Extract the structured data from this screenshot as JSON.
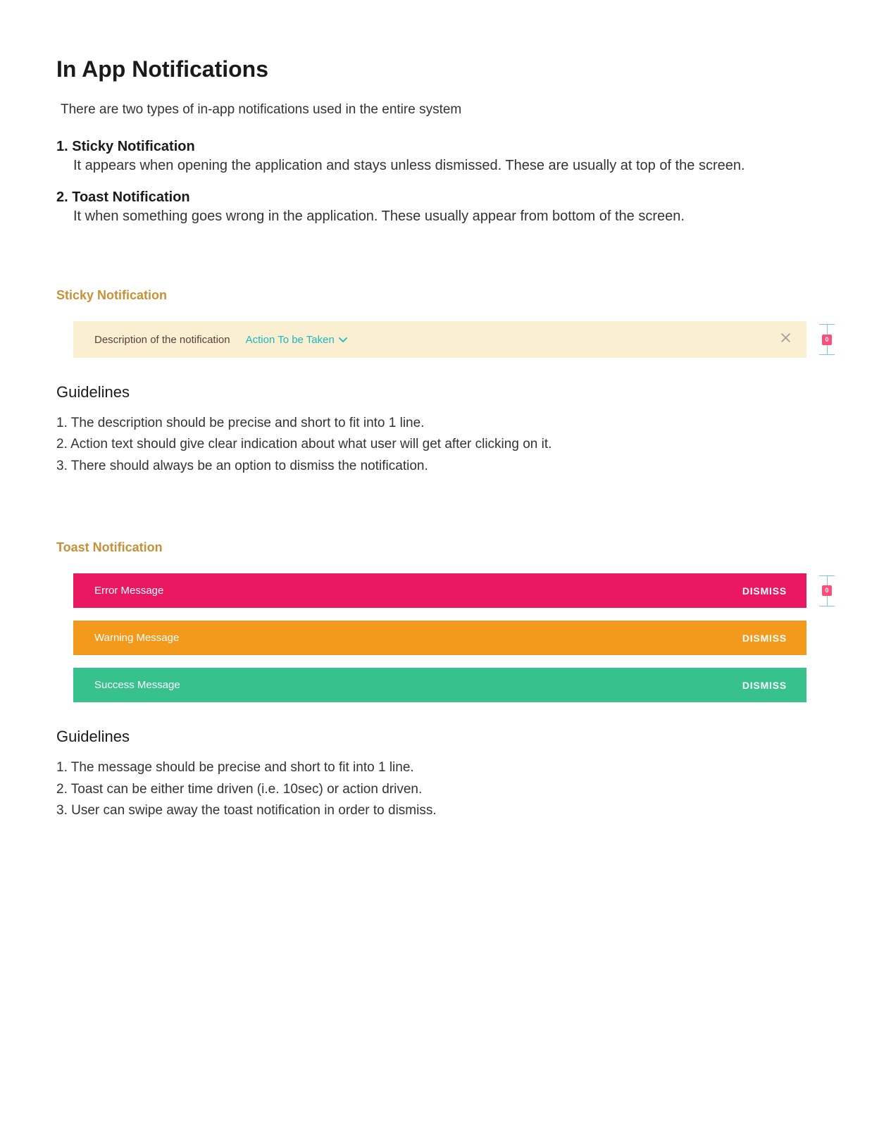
{
  "title": "In App Notifications",
  "intro": "There are two types of in-app notifications used in the entire system",
  "types": {
    "sticky": {
      "title": "1. Sticky Notification",
      "desc": "It appears when opening the application and stays unless dismissed. These are usually at top of the screen."
    },
    "toast": {
      "title": "2. Toast Notification",
      "desc": "It when something goes wrong in the application. These usually appear from bottom of the screen."
    }
  },
  "sticky_section": {
    "label": "Sticky Notification",
    "description": "Description of the notification",
    "action": "Action To be Taken"
  },
  "guidelines1": {
    "heading": "Guidelines",
    "items": [
      "1. The description should be precise and short to fit into 1 line.",
      "2. Action text should give clear indication about what user will get after clicking on it.",
      "3. There should always be an option to dismiss the notification."
    ]
  },
  "toast_section": {
    "label": "Toast Notification",
    "error": {
      "text": "Error Message",
      "dismiss": "DISMISS"
    },
    "warning": {
      "text": "Warning Message",
      "dismiss": "DISMISS"
    },
    "success": {
      "text": "Success Message",
      "dismiss": "DISMISS"
    }
  },
  "guidelines2": {
    "heading": "Guidelines",
    "items": [
      "1. The message should be precise and short to fit into 1 line.",
      "2. Toast can be either time driven (i.e. 10sec) or action driven.",
      "3. User can swipe away the toast notification in order to dismiss."
    ]
  }
}
